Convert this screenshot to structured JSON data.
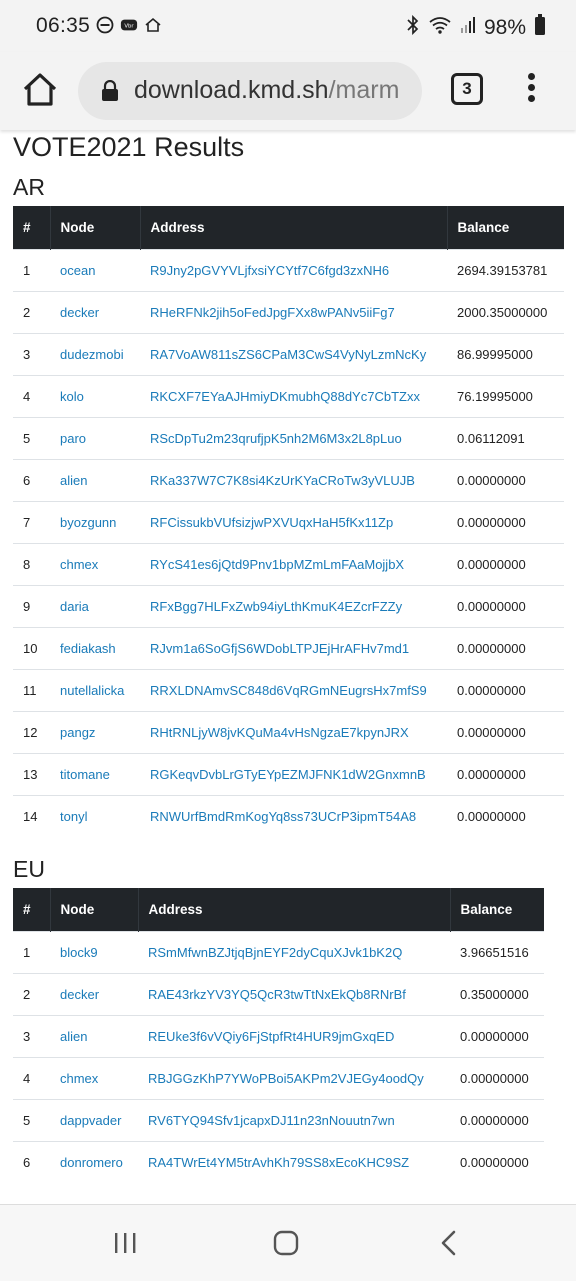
{
  "status_bar": {
    "time": "06:35",
    "battery": "98%",
    "icons": [
      "dnd-icon",
      "viber-icon",
      "home-network-icon",
      "bluetooth-icon",
      "wifi-icon",
      "signal-icon",
      "battery-icon"
    ]
  },
  "browser": {
    "url_host": "download.kmd.sh",
    "url_path": "/marm",
    "tab_count": "3"
  },
  "page": {
    "title": "VOTE2021 Results",
    "sections": [
      {
        "name": "AR",
        "headers": [
          "#",
          "Node",
          "Address",
          "Balance"
        ],
        "rows": [
          [
            "1",
            "ocean",
            "R9Jny2pGVYVLjfxsiYCYtf7C6fgd3zxNH6",
            "2694.39153781"
          ],
          [
            "2",
            "decker",
            "RHeRFNk2jih5oFedJpgFXx8wPANv5iiFg7",
            "2000.35000000"
          ],
          [
            "3",
            "dudezmobi",
            "RA7VoAW811sZS6CPaM3CwS4VyNyLzmNcKy",
            "86.99995000"
          ],
          [
            "4",
            "kolo",
            "RKCXF7EYaAJHmiyDKmubhQ88dYc7CbTZxx",
            "76.19995000"
          ],
          [
            "5",
            "paro",
            "RScDpTu2m23qrufjpK5nh2M6M3x2L8pLuo",
            "0.06112091"
          ],
          [
            "6",
            "alien",
            "RKa337W7C7K8si4KzUrKYaCRoTw3yVLUJB",
            "0.00000000"
          ],
          [
            "7",
            "byozgunn",
            "RFCissukbVUfsizjwPXVUqxHaH5fKx11Zp",
            "0.00000000"
          ],
          [
            "8",
            "chmex",
            "RYcS41es6jQtd9Pnv1bpMZmLmFAaMojjbX",
            "0.00000000"
          ],
          [
            "9",
            "daria",
            "RFxBgg7HLFxZwb94iyLthKmuK4EZcrFZZy",
            "0.00000000"
          ],
          [
            "10",
            "fediakash",
            "RJvm1a6SoGfjS6WDobLTPJEjHrAFHv7md1",
            "0.00000000"
          ],
          [
            "11",
            "nutellalicka",
            "RRXLDNAmvSC848d6VqRGmNEugrsHx7mfS9",
            "0.00000000"
          ],
          [
            "12",
            "pangz",
            "RHtRNLjyW8jvKQuMa4vHsNgzaE7kpynJRX",
            "0.00000000"
          ],
          [
            "13",
            "titomane",
            "RGKeqvDvbLrGTyEYpEZMJFNK1dW2GnxmnB",
            "0.00000000"
          ],
          [
            "14",
            "tonyl",
            "RNWUrfBmdRmKogYq8ss73UCrP3ipmT54A8",
            "0.00000000"
          ]
        ]
      },
      {
        "name": "EU",
        "headers": [
          "#",
          "Node",
          "Address",
          "Balance"
        ],
        "rows": [
          [
            "1",
            "block9",
            "RSmMfwnBZJtjqBjnEYF2dyCquXJvk1bK2Q",
            "3.96651516"
          ],
          [
            "2",
            "decker",
            "RAE43rkzYV3YQ5QcR3twTtNxEkQb8RNrBf",
            "0.35000000"
          ],
          [
            "3",
            "alien",
            "REUke3f6vVQiy6FjStpfRt4HUR9jmGxqED",
            "0.00000000"
          ],
          [
            "4",
            "chmex",
            "RBJGGzKhP7YWoPBoi5AKPm2VJEGy4oodQy",
            "0.00000000"
          ],
          [
            "5",
            "dappvader",
            "RV6TYQ94Sfv1jcapxDJ11n23nNouutn7wn",
            "0.00000000"
          ],
          [
            "6",
            "donromero",
            "RA4TWrEt4YM5trAvhKh79SS8xEcoKHC9SZ",
            "0.00000000"
          ]
        ]
      }
    ]
  },
  "nav_bar": {
    "buttons": [
      "recent-apps-icon",
      "home-icon",
      "back-icon"
    ]
  }
}
